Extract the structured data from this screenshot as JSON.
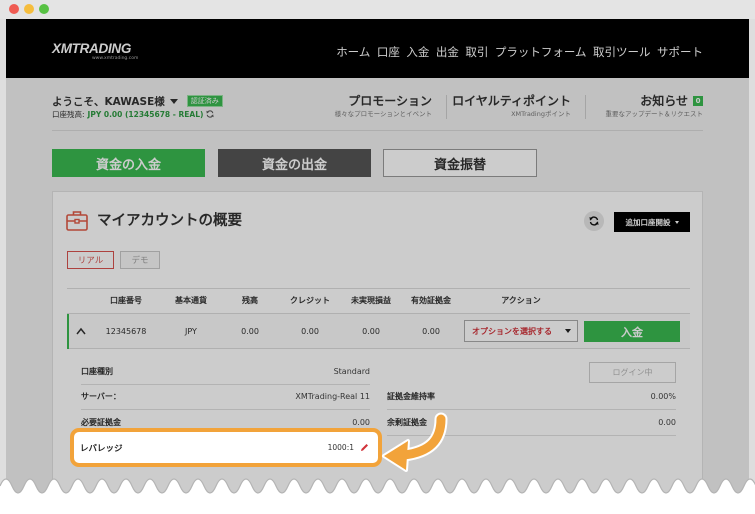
{
  "window": {
    "traffic_lights": [
      "#ef5b52",
      "#f5bd3d",
      "#58c244"
    ]
  },
  "colors": {
    "brand_green": "#3ab951",
    "accent_red": "#d1323a",
    "highlight_orange": "#f2a33a",
    "dark_button": "#555555"
  },
  "icons": {
    "account_overview": "briefcase-icon",
    "refresh": "refresh-icon",
    "collapse_row": "chevron-up-icon",
    "edit_leverage": "pencil-icon"
  },
  "header": {
    "logo": "XMTRADING",
    "logo_sub": "www.xmtrading.com",
    "nav": [
      "ホーム",
      "口座",
      "入金",
      "出金",
      "取引",
      "プラットフォーム",
      "取引ツール",
      "サポート"
    ]
  },
  "user": {
    "greeting": "ようこそ、KAWASE様",
    "verified_badge": "認証済み",
    "balance_label": "口座残高:",
    "balance_value": "JPY 0.00 (12345678 - REAL)"
  },
  "quick_links": [
    {
      "title": "プロモーション",
      "subtitle": "様々なプロモーションとイベント"
    },
    {
      "title": "ロイヤルティポイント",
      "subtitle": "XMTradingポイント"
    },
    {
      "title": "お知らせ",
      "subtitle": "重要なアップデート＆リクエスト",
      "badge": "0"
    }
  ],
  "funds": {
    "deposit": "資金の入金",
    "withdraw": "資金の出金",
    "transfer": "資金振替"
  },
  "overview": {
    "title": "マイアカウントの概要",
    "add_account": "追加口座開設",
    "tabs": {
      "real": "リアル",
      "demo": "デモ"
    },
    "columns": [
      "口座番号",
      "基本通貨",
      "残高",
      "クレジット",
      "未実現損益",
      "有効証拠金",
      "アクション"
    ],
    "account_row": {
      "account_number": "12345678",
      "currency": "JPY",
      "balance": "0.00",
      "credit": "0.00",
      "unrealized_pnl": "0.00",
      "equity": "0.00",
      "options_placeholder": "オプションを選択する",
      "deposit_button": "入金"
    },
    "details_left": [
      {
        "label": "口座種別",
        "value": "Standard"
      },
      {
        "label": "サーバー：",
        "value": "XMTrading-Real 11"
      },
      {
        "label": "必要証拠金",
        "value": "0.00"
      },
      {
        "label": "レバレッジ",
        "value": "1000:1"
      }
    ],
    "login_button": "ログイン中",
    "details_right": [
      {
        "label": "証拠金維持率",
        "value": "0.00%"
      },
      {
        "label": "余剰証拠金",
        "value": "0.00"
      }
    ]
  }
}
